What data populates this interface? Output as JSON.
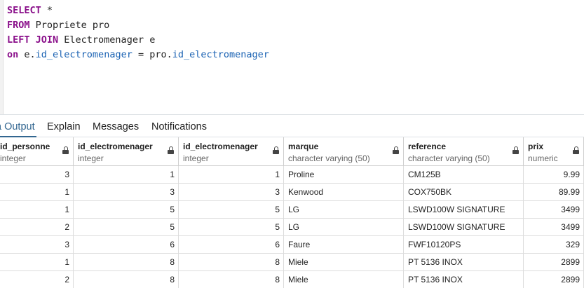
{
  "query": {
    "line1": {
      "kw": "SELECT",
      "rest": " *"
    },
    "line2": {
      "kw": "FROM",
      "rest": " Propriete pro"
    },
    "line3": {
      "kw": "LEFT JOIN",
      "rest": " Electromenager e"
    },
    "line4": {
      "kw": "on",
      "p1": " e.",
      "c1": "id_electromenager",
      "p2": " = pro.",
      "c2": "id_electromenager"
    }
  },
  "tabs": {
    "output": "a Output",
    "explain": "Explain",
    "messages": "Messages",
    "notifications": "Notifications"
  },
  "columns": [
    {
      "name": "id_personne",
      "type": "integer"
    },
    {
      "name": "id_electromenager",
      "type": "integer"
    },
    {
      "name": "id_electromenager",
      "type": "integer"
    },
    {
      "name": "marque",
      "type": "character varying (50)"
    },
    {
      "name": "reference",
      "type": "character varying (50)"
    },
    {
      "name": "prix",
      "type": "numeric"
    }
  ],
  "rows": [
    [
      "3",
      "1",
      "1",
      "Proline",
      "CM125B",
      "9.99"
    ],
    [
      "1",
      "3",
      "3",
      "Kenwood",
      "COX750BK",
      "89.99"
    ],
    [
      "1",
      "5",
      "5",
      "LG",
      "LSWD100W SIGNATURE",
      "3499"
    ],
    [
      "2",
      "5",
      "5",
      "LG",
      "LSWD100W SIGNATURE",
      "3499"
    ],
    [
      "3",
      "6",
      "6",
      "Faure",
      "FWF10120PS",
      "329"
    ],
    [
      "1",
      "8",
      "8",
      "Miele",
      "PT 5136 INOX",
      "2899"
    ],
    [
      "2",
      "8",
      "8",
      "Miele",
      "PT 5136 INOX",
      "2899"
    ]
  ],
  "colors": {
    "keyword": "#8a0f8a",
    "column_ref": "#1a62b3",
    "active_tab": "#326690"
  },
  "icons": {
    "column_lock": "lock-icon"
  }
}
